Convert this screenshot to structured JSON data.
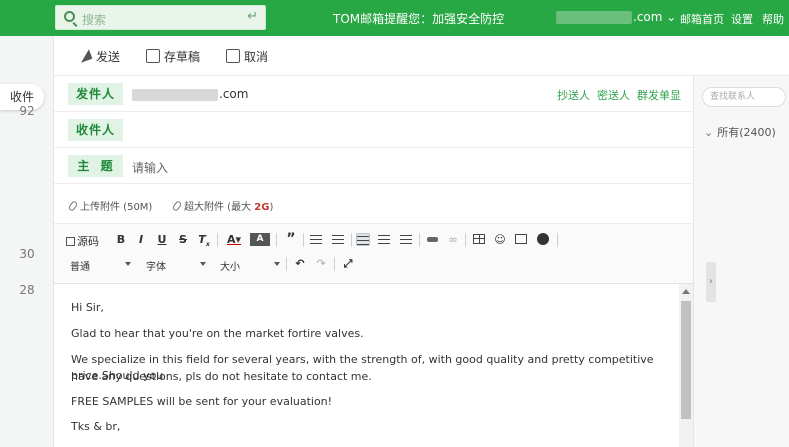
{
  "topbar": {
    "search_placeholder": "搜索",
    "notice": "TOM邮箱提醒您：加强安全防控",
    "account_domain": ".com",
    "links": [
      "邮箱首页",
      "设置",
      "帮助"
    ]
  },
  "left": {
    "recv_tab": "收件",
    "numbers": [
      "92",
      "30",
      "28"
    ]
  },
  "toolbar": {
    "send": "发送",
    "save_draft": "存草稿",
    "cancel": "取消"
  },
  "header": {
    "from_label": "发件人",
    "from_domain": ".com",
    "to_label": "收件人",
    "subject_label": "主  题",
    "subject_placeholder": "请输入",
    "cc": "抄送人",
    "bcc": "密送人",
    "separate": "群发单显"
  },
  "attachments": {
    "upload": "上传附件 (50M)",
    "large_prefix": "超大附件 (最大 ",
    "large_size": "2G",
    "large_suffix": ")"
  },
  "editor": {
    "source": "源码",
    "format_select": "普通",
    "font_select": "字体",
    "size_select": "大小"
  },
  "right": {
    "contact_search_placeholder": "查找联系人",
    "all_contacts": "所有(2400)"
  },
  "body": {
    "greeting": "Hi Sir,",
    "line1": "Glad to hear that you're on the market fortire valves.",
    "line2a": "We specialize in this field for several years, with the strength of, with good quality and pretty competitive price.Should you",
    "line2b": "have any questions, pls do not hesitate to contact me.",
    "line3": "FREE SAMPLES will be sent for your evaluation!",
    "closing": "Tks & br,"
  },
  "colors": {
    "brand_green": "#28a745",
    "label_bg": "#e1f3e4",
    "label_text": "#1f8a3b",
    "link_green": "#2ea24b"
  }
}
